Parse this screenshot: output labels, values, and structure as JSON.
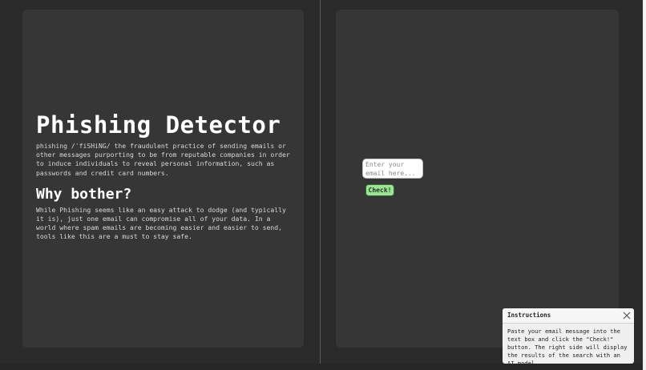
{
  "left": {
    "title": "Phishing Detector",
    "definition": "phishing /ˈfiSHiNG/ the fraudulent practice of sending emails or other messages purporting to be from reputable companies in order to induce individuals to reveal personal information, such as passwords and credit card numbers.",
    "subtitle": "Why bother?",
    "body": "While Phishing seems like an easy attack to dodge (and typically it is), just one email can compromise all of your data. In a world where spam emails are becoming easier and easier to send, tools like this are a must to stay safe."
  },
  "right": {
    "email_placeholder": "Enter your email here...",
    "email_value": "",
    "check_label": "Check!"
  },
  "instructions": {
    "title": "Instructions",
    "body": "Paste your email message into the text box and click the \"Check!\" button. The right side will display the results of the search with an AI model.",
    "close_icon": "close-icon"
  },
  "colors": {
    "background": "#2a2a2a",
    "panel": "#363636",
    "check_button": "#9ee29a",
    "check_border": "#2f6b2c"
  }
}
